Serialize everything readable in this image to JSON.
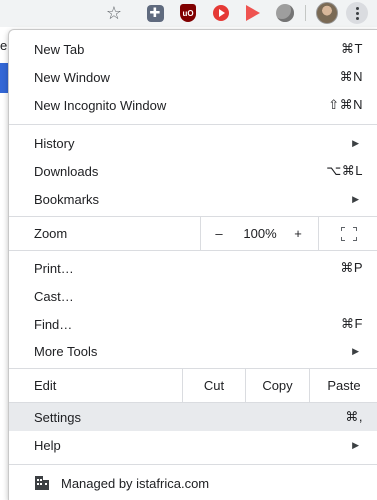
{
  "page": {
    "partial_letter": "e"
  },
  "toolbar": {
    "star_icon": "star-icon",
    "extensions": [
      "puzzle-extension-icon",
      "ublock-icon",
      "youtube-extension-icon",
      "play-extension-icon",
      "gray-extension-icon"
    ],
    "ublock_text": "uO",
    "puzzle_text": "✚"
  },
  "menu": {
    "new_tab": {
      "label": "New Tab",
      "shortcut": "⌘T"
    },
    "new_window": {
      "label": "New Window",
      "shortcut": "⌘N"
    },
    "new_incognito": {
      "label": "New Incognito Window",
      "shortcut": "⇧⌘N"
    },
    "history": {
      "label": "History"
    },
    "downloads": {
      "label": "Downloads",
      "shortcut": "⌥⌘L"
    },
    "bookmarks": {
      "label": "Bookmarks"
    },
    "zoom": {
      "label": "Zoom",
      "minus": "–",
      "value": "100%",
      "plus": "+"
    },
    "print": {
      "label": "Print…",
      "shortcut": "⌘P"
    },
    "cast": {
      "label": "Cast…"
    },
    "find": {
      "label": "Find…",
      "shortcut": "⌘F"
    },
    "more_tools": {
      "label": "More Tools"
    },
    "edit": {
      "label": "Edit",
      "cut": "Cut",
      "copy": "Copy",
      "paste": "Paste"
    },
    "settings": {
      "label": "Settings",
      "shortcut": "⌘,"
    },
    "help": {
      "label": "Help"
    },
    "managed": {
      "label": "Managed by istafrica.com"
    },
    "submenu_chevron": "▶"
  },
  "colors": {
    "highlight": "#e8eaed",
    "separator": "#dadce0",
    "accent_page": "#3367d6"
  }
}
